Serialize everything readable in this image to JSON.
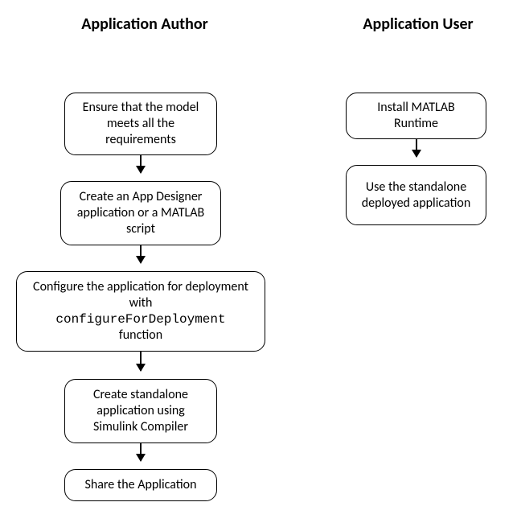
{
  "headers": {
    "author": "Application Author",
    "user": "Application User"
  },
  "author": {
    "n1": "Ensure that the model meets all the requirements",
    "n2": "Create an App Designer application or a MATLAB script",
    "n3_pre": "Configure the application for deployment with",
    "n3_code": "configureForDeployment",
    "n3_post": "function",
    "n4": "Create standalone application using Simulink Compiler",
    "n5": "Share the Application"
  },
  "user": {
    "n1": "Install MATLAB Runtime",
    "n2": "Use the standalone deployed application"
  },
  "chart_data": {
    "type": "flowchart",
    "lanes": [
      {
        "name": "Application Author",
        "nodes": [
          {
            "id": "a1",
            "text": "Ensure that the model meets all the requirements"
          },
          {
            "id": "a2",
            "text": "Create an App Designer application or a MATLAB script"
          },
          {
            "id": "a3",
            "text": "Configure the application for deployment with configureForDeployment function"
          },
          {
            "id": "a4",
            "text": "Create standalone application using Simulink Compiler"
          },
          {
            "id": "a5",
            "text": "Share the Application"
          }
        ],
        "edges": [
          {
            "from": "a1",
            "to": "a2"
          },
          {
            "from": "a2",
            "to": "a3"
          },
          {
            "from": "a3",
            "to": "a4"
          },
          {
            "from": "a4",
            "to": "a5"
          }
        ]
      },
      {
        "name": "Application User",
        "nodes": [
          {
            "id": "u1",
            "text": "Install MATLAB Runtime"
          },
          {
            "id": "u2",
            "text": "Use the standalone deployed application"
          }
        ],
        "edges": [
          {
            "from": "u1",
            "to": "u2"
          }
        ]
      }
    ]
  }
}
